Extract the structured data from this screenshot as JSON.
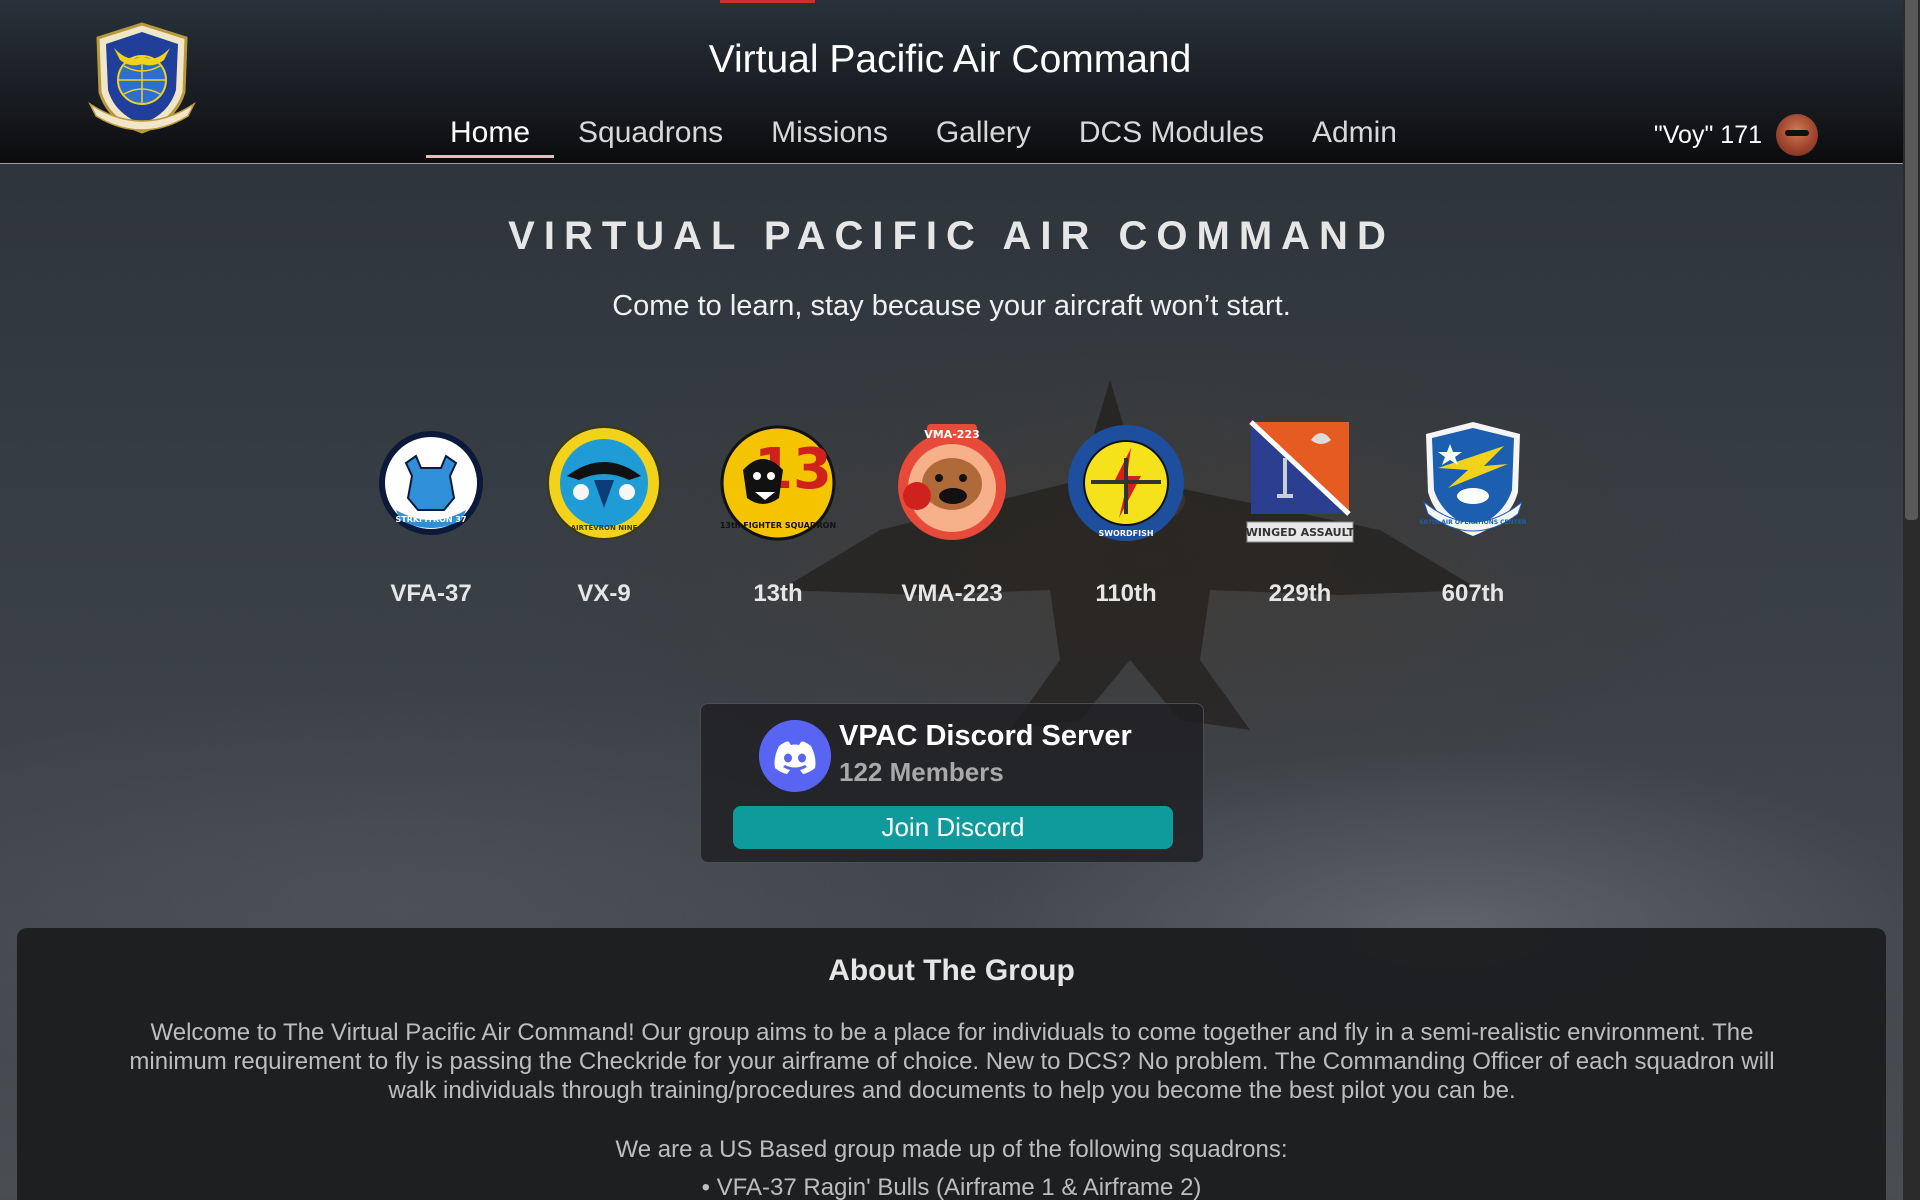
{
  "header": {
    "site_title": "Virtual Pacific Air Command",
    "logo_icon": "vpac-shield-logo",
    "nav": [
      {
        "label": "Home",
        "active": true
      },
      {
        "label": "Squadrons"
      },
      {
        "label": "Missions"
      },
      {
        "label": "Gallery"
      },
      {
        "label": "DCS Modules"
      },
      {
        "label": "Admin"
      }
    ],
    "user": {
      "name": "\"Voy\" 171",
      "avatar_icon": "user-avatar"
    }
  },
  "hero": {
    "title": "VIRTUAL PACIFIC AIR COMMAND",
    "tagline": "Come to learn, stay because your aircraft won’t start."
  },
  "squadrons": [
    {
      "label": "VFA-37",
      "patch_text": "STRKFITRON 37",
      "icon": "vfa37-bull-patch",
      "colors": [
        "#0b1a3a",
        "#2f8fd8",
        "#ffffff"
      ]
    },
    {
      "label": "VX-9",
      "patch_text": "AIRTEVRON NINE",
      "icon": "vx9-patch",
      "colors": [
        "#f2d21b",
        "#1f9bd6",
        "#0a3d7a"
      ]
    },
    {
      "label": "13th",
      "patch_text": "13th FIGHTER SQUADRON",
      "icon": "13th-panther-patch",
      "colors": [
        "#f4c400",
        "#d0221d",
        "#000000"
      ]
    },
    {
      "label": "VMA-223",
      "patch_text": "VMA-223",
      "icon": "vma223-bulldog-patch",
      "colors": [
        "#e84a3a",
        "#f6b08a",
        "#8a4a2a"
      ]
    },
    {
      "label": "110th",
      "patch_text": "SWORDFISH",
      "icon": "110th-swordfish-patch",
      "colors": [
        "#f5e21a",
        "#1d4f9e",
        "#d0221d"
      ]
    },
    {
      "label": "229th",
      "patch_text": "WINGED ASSAULT",
      "icon": "229th-shield-patch",
      "colors": [
        "#e65b22",
        "#2b3e8f",
        "#ffffff"
      ]
    },
    {
      "label": "607th",
      "patch_text": "607th AIR OPERATIONS CENTER",
      "icon": "607th-shield-patch",
      "colors": [
        "#1c5fb0",
        "#f2d21b",
        "#ffffff"
      ]
    }
  ],
  "discord": {
    "name": "VPAC Discord Server",
    "members": "122 Members",
    "join_label": "Join Discord",
    "icon": "discord-icon",
    "accent": "#5865f2",
    "button_color": "#0f9b9b"
  },
  "about": {
    "title": "About The Group",
    "body_lines": [
      "Welcome to The Virtual Pacific Air Command! Our group aims to be a place for individuals to come together and fly in a semi-realistic environment. The",
      "minimum requirement to fly is passing the Checkride for your airframe of choice. New to DCS? No problem. The Commanding Officer of each squadron will",
      "walk individuals through training/procedures and documents to help you become the best pilot you can be."
    ],
    "subheading": "We are a US Based group made up of the following squadrons:",
    "list": [
      "VFA-37 Ragin' Bulls (Airframe 1 & Airframe 2)"
    ]
  }
}
